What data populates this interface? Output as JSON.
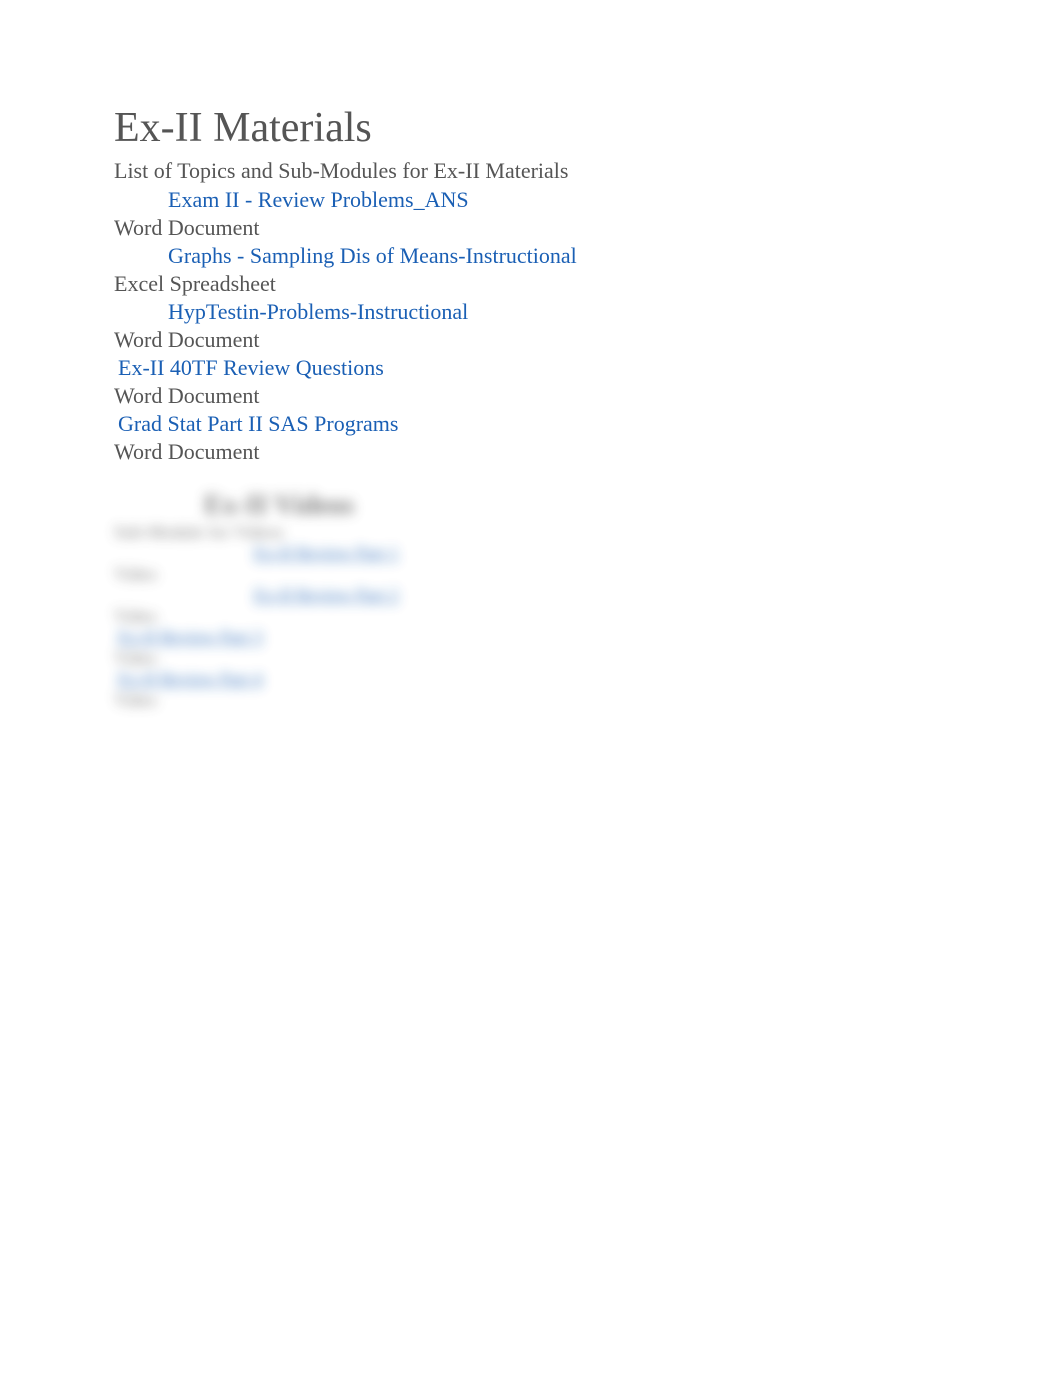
{
  "title": "Ex-II Materials",
  "subtitle": "List of Topics and Sub-Modules for Ex-II Materials",
  "items": [
    {
      "bullet": "",
      "link": "Exam II - Review Problems_ANS",
      "meta": "Word Document",
      "indent": true
    },
    {
      "bullet": "",
      "link": "Graphs - Sampling Dis of Means-Instructional",
      "meta": "Excel Spreadsheet",
      "indent": true
    },
    {
      "bullet": "",
      "link": "HypTestin-Problems-Instructional",
      "meta": "Word Document",
      "indent": true
    },
    {
      "bullet": "",
      "link": "Ex-II 40TF Review Questions",
      "meta": "Word Document",
      "indent": false
    },
    {
      "bullet": "",
      "link": "Grad Stat Part II SAS Programs",
      "meta": "Word Document",
      "indent": false
    }
  ],
  "blurred": {
    "heading": "Ex-II Videos",
    "sub1": "Sub-Module for Videos",
    "rows": [
      {
        "bullet": "",
        "link": "Ex-II Review Part 1",
        "meta": "Video",
        "deep": true
      },
      {
        "bullet": "",
        "link": "Ex-II Review Part 2",
        "meta": "Video",
        "deep": true
      },
      {
        "bullet": "",
        "link": "Ex-II Review Part 3",
        "meta": "Video",
        "deep": false
      },
      {
        "bullet": "",
        "link": "Ex-II Review Part 4",
        "meta": "Video",
        "deep": false
      }
    ]
  }
}
